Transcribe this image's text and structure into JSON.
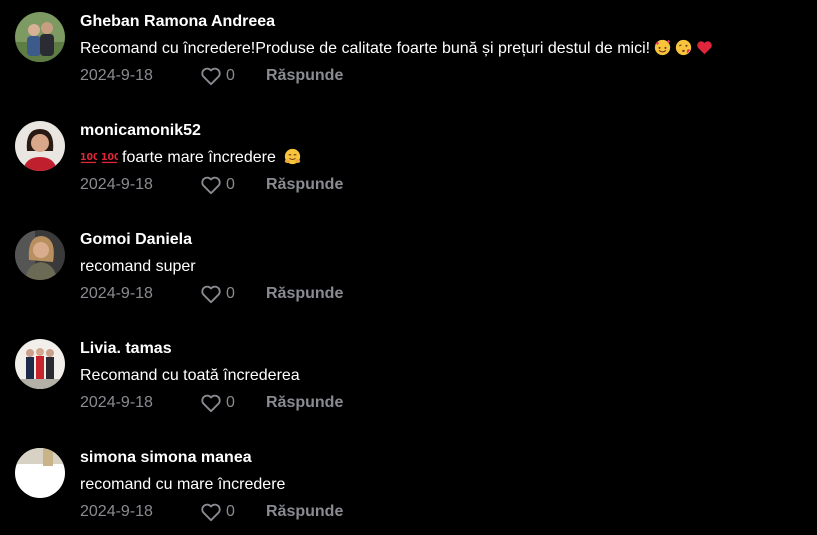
{
  "colors": {
    "background": "#000000",
    "text": "#ffffff",
    "meta": "#8a8b91"
  },
  "comments": [
    {
      "username": "Gheban Ramona Andreea",
      "text": "Recomand cu încredere!Produse de calitate foarte bună și prețuri destul de mici!",
      "trailing_emoji": [
        "smiling-face-with-hearts",
        "face-blowing-kiss",
        "red-heart"
      ],
      "date": "2024-9-18",
      "likes": "0",
      "reply_label": "Răspunde"
    },
    {
      "username": "monicamonik52",
      "leading_emoji": [
        "hundred-points",
        "hundred-points"
      ],
      "text": "foarte mare încredere",
      "trailing_emoji": [
        "hugging-face"
      ],
      "date": "2024-9-18",
      "likes": "0",
      "reply_label": "Răspunde"
    },
    {
      "username": "Gomoi Daniela",
      "text": "recomand super",
      "date": "2024-9-18",
      "likes": "0",
      "reply_label": "Răspunde"
    },
    {
      "username": "Livia. tamas",
      "text": "Recomand cu toată încrederea",
      "date": "2024-9-18",
      "likes": "0",
      "reply_label": "Răspunde"
    },
    {
      "username": "simona simona manea",
      "text": "recomand cu mare încredere",
      "date": "2024-9-18",
      "likes": "0",
      "reply_label": "Răspunde"
    }
  ]
}
